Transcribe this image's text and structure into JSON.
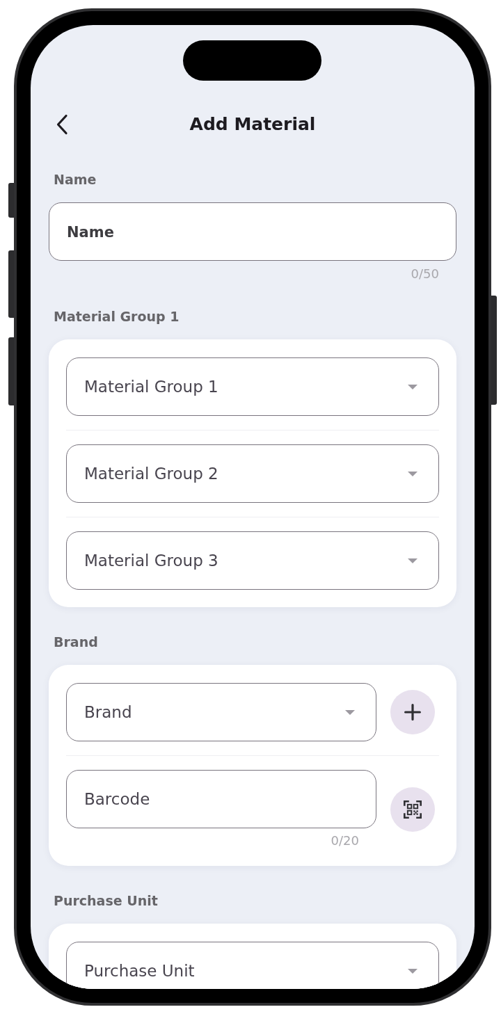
{
  "header": {
    "title": "Add Material"
  },
  "sections": [
    {
      "label": "Name",
      "kind": "plain",
      "fields": [
        {
          "kind": "text",
          "placeholder": "Name",
          "counter": "0/50"
        }
      ]
    },
    {
      "label": "Material Group 1",
      "kind": "card",
      "fields": [
        {
          "kind": "dropdown",
          "placeholder": "Material Group 1"
        },
        {
          "kind": "dropdown",
          "placeholder": "Material Group 2"
        },
        {
          "kind": "dropdown",
          "placeholder": "Material Group 3"
        }
      ]
    },
    {
      "label": "Brand",
      "kind": "card",
      "fields": [
        {
          "kind": "dropdown",
          "placeholder": "Brand",
          "button": {
            "kind": "add"
          }
        },
        {
          "kind": "text",
          "placeholder": "Barcode",
          "counter": "0/20",
          "button": {
            "kind": "scan"
          }
        }
      ]
    },
    {
      "label": "Purchase Unit",
      "kind": "card",
      "fields": [
        {
          "kind": "dropdown",
          "placeholder": "Purchase Unit"
        }
      ]
    }
  ]
}
